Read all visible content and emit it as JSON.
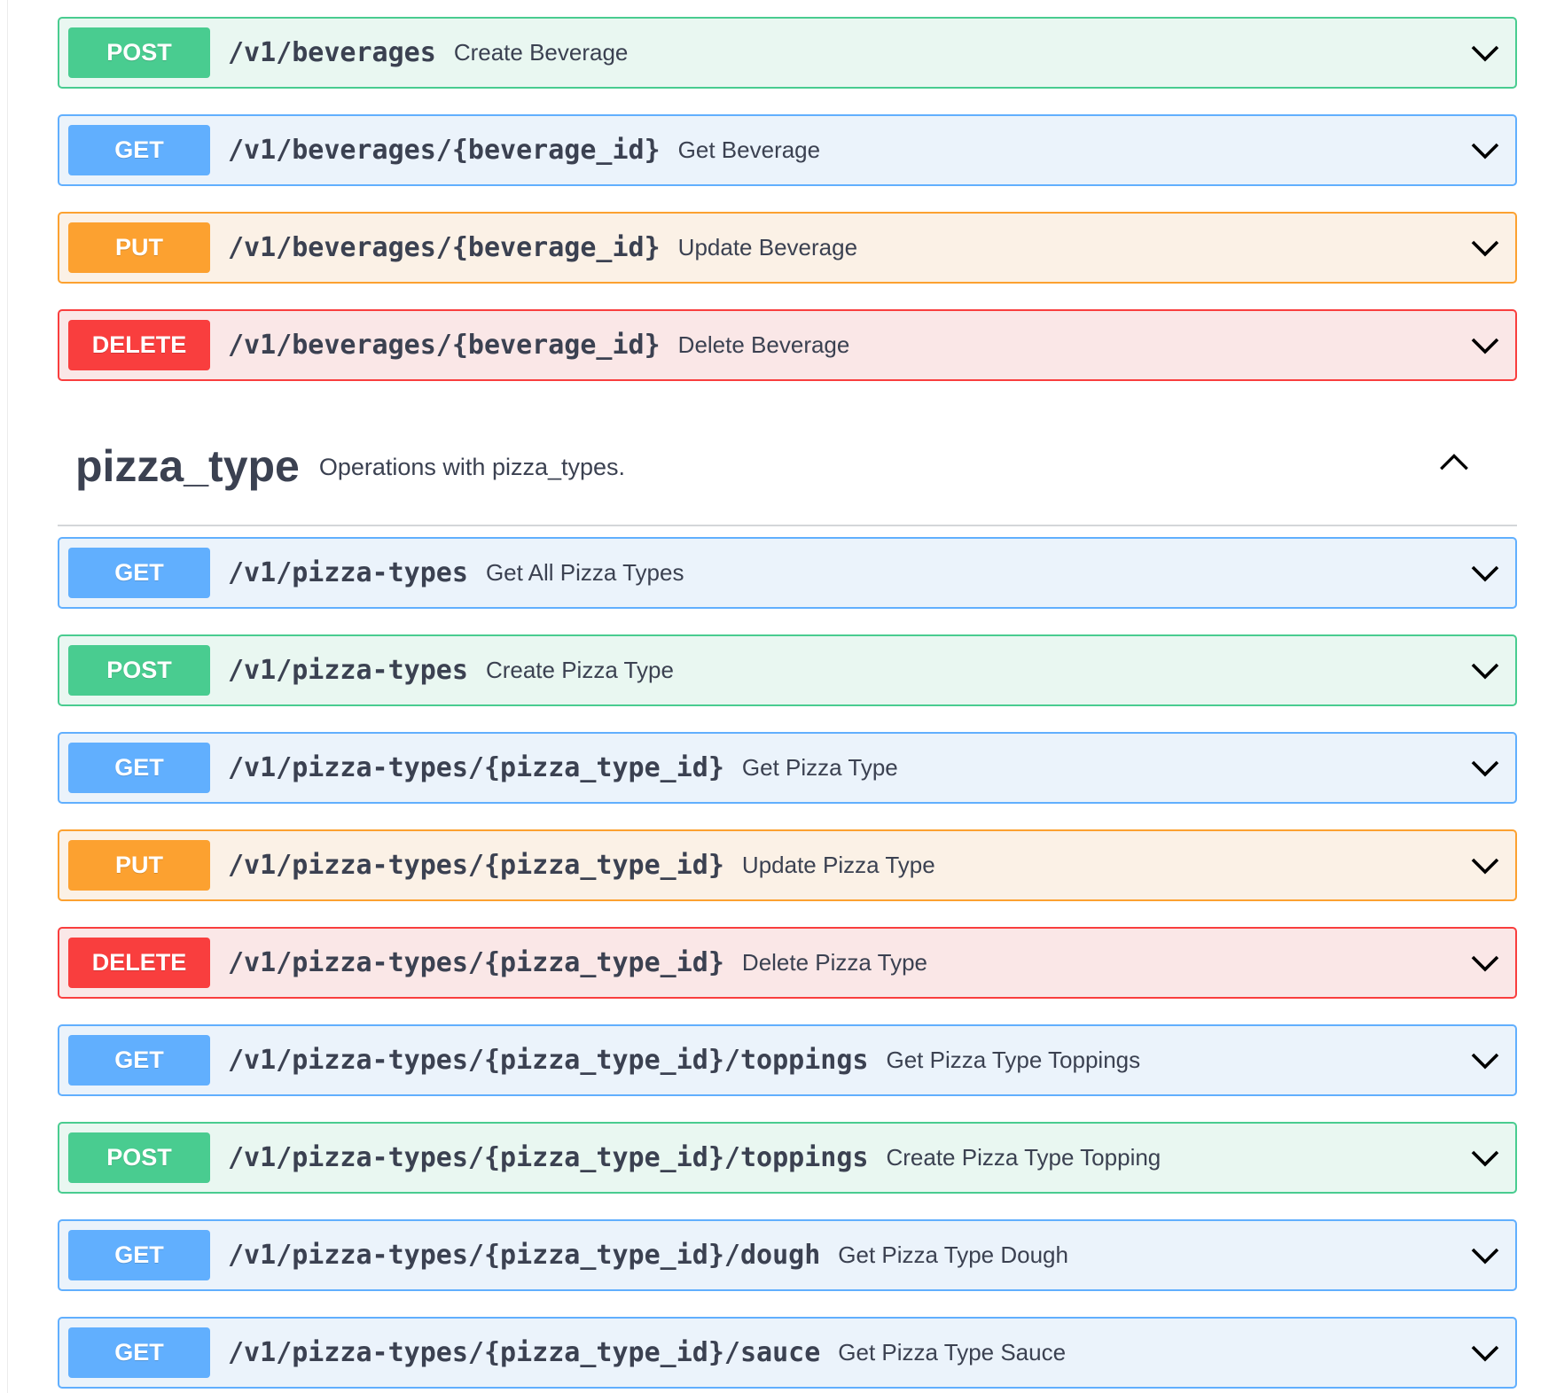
{
  "operations_top": [
    {
      "method": "POST",
      "kind": "post",
      "path": "/v1/beverages",
      "summary": "Create Beverage"
    },
    {
      "method": "GET",
      "kind": "get",
      "path": "/v1/beverages/{beverage_id}",
      "summary": "Get Beverage"
    },
    {
      "method": "PUT",
      "kind": "put",
      "path": "/v1/beverages/{beverage_id}",
      "summary": "Update Beverage"
    },
    {
      "method": "DELETE",
      "kind": "delete",
      "path": "/v1/beverages/{beverage_id}",
      "summary": "Delete Beverage"
    }
  ],
  "section": {
    "name": "pizza_type",
    "description": "Operations with pizza_types.",
    "expanded": true
  },
  "operations_pizza": [
    {
      "method": "GET",
      "kind": "get",
      "path": "/v1/pizza-types",
      "summary": "Get All Pizza Types"
    },
    {
      "method": "POST",
      "kind": "post",
      "path": "/v1/pizza-types",
      "summary": "Create Pizza Type"
    },
    {
      "method": "GET",
      "kind": "get",
      "path": "/v1/pizza-types/{pizza_type_id}",
      "summary": "Get Pizza Type"
    },
    {
      "method": "PUT",
      "kind": "put",
      "path": "/v1/pizza-types/{pizza_type_id}",
      "summary": "Update Pizza Type"
    },
    {
      "method": "DELETE",
      "kind": "delete",
      "path": "/v1/pizza-types/{pizza_type_id}",
      "summary": "Delete Pizza Type"
    },
    {
      "method": "GET",
      "kind": "get",
      "path": "/v1/pizza-types/{pizza_type_id}/toppings",
      "summary": "Get Pizza Type Toppings"
    },
    {
      "method": "POST",
      "kind": "post",
      "path": "/v1/pizza-types/{pizza_type_id}/toppings",
      "summary": "Create Pizza Type Topping"
    },
    {
      "method": "GET",
      "kind": "get",
      "path": "/v1/pizza-types/{pizza_type_id}/dough",
      "summary": "Get Pizza Type Dough"
    },
    {
      "method": "GET",
      "kind": "get",
      "path": "/v1/pizza-types/{pizza_type_id}/sauce",
      "summary": "Get Pizza Type Sauce"
    }
  ],
  "icons": {
    "expand": "chevron-down-icon",
    "collapse": "chevron-up-icon"
  },
  "colors": {
    "post": "#49cc90",
    "get": "#61affe",
    "put": "#fca130",
    "delete": "#f93e3e",
    "text": "#3b4151"
  }
}
